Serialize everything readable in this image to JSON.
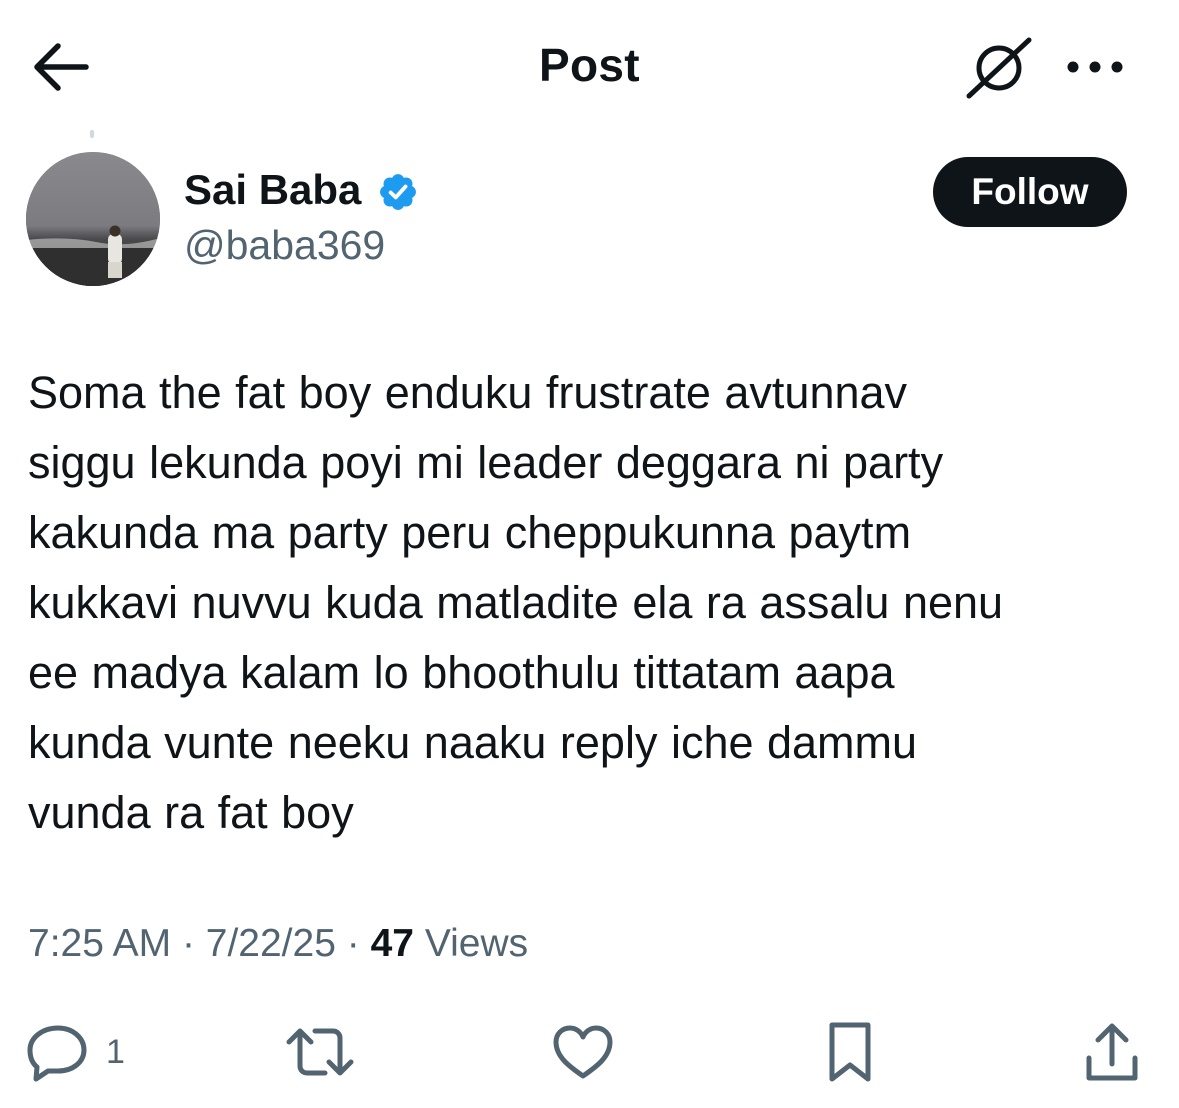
{
  "header": {
    "title": "Post",
    "back_icon": "arrow-left-icon",
    "grok_icon": "grok-icon",
    "more_icon": "more-dots-icon"
  },
  "author": {
    "display_name": "Sai Baba",
    "username": "@baba369",
    "verified": true,
    "verified_color": "#1d9bf0",
    "follow_label": "Follow"
  },
  "tweet": {
    "text": "Soma the fat boy enduku frustrate avtunnav\nsiggu lekunda poyi mi leader deggara ni party\nkakunda ma party peru cheppukunna paytm\nkukkavi nuvvu kuda matladite ela ra assalu nenu\nee madya kalam lo bhoothulu tittatam aapa\nkunda vunte  neeku naaku reply iche dammu\nvunda ra fat boy",
    "time": "7:25 AM",
    "date": "7/22/25",
    "separator": "·",
    "views_count": "47",
    "views_label": "Views"
  },
  "actions": {
    "reply_count": "1",
    "reply_icon": "reply-icon",
    "repost_icon": "repost-icon",
    "like_icon": "heart-icon",
    "bookmark_icon": "bookmark-icon",
    "share_icon": "share-icon"
  },
  "colors": {
    "text_primary": "#0f1419",
    "text_secondary": "#536471",
    "follow_bg": "#0f1419",
    "follow_text": "#ffffff",
    "icon": "#536471"
  }
}
